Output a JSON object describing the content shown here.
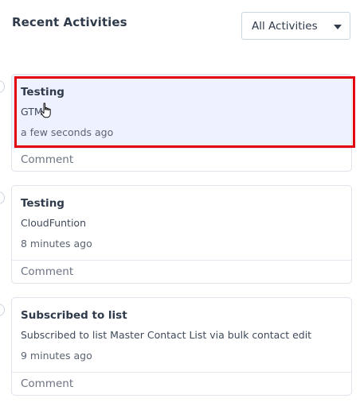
{
  "header": {
    "title": "Recent Activities",
    "filter": {
      "selected": "All Activities",
      "icon": "chevron-down-icon"
    }
  },
  "activities": [
    {
      "title": "Testing",
      "description": "GTM",
      "time": "a few seconds ago",
      "comment_label": "Comment",
      "highlighted": true
    },
    {
      "title": "Testing",
      "description": "CloudFuntion",
      "time": "8 minutes ago",
      "comment_label": "Comment",
      "highlighted": false
    },
    {
      "title": "Subscribed to list",
      "description": "Subscribed to list Master Contact List via bulk contact edit",
      "time": "9 minutes ago",
      "comment_label": "Comment",
      "highlighted": false
    }
  ],
  "colors": {
    "highlight_border": "#e3000f",
    "highlight_background": "#eef1ff",
    "card_border": "#dfe3ea",
    "text_primary": "#2f3a4a"
  },
  "cursor": {
    "icon": "hand-pointer-icon"
  }
}
